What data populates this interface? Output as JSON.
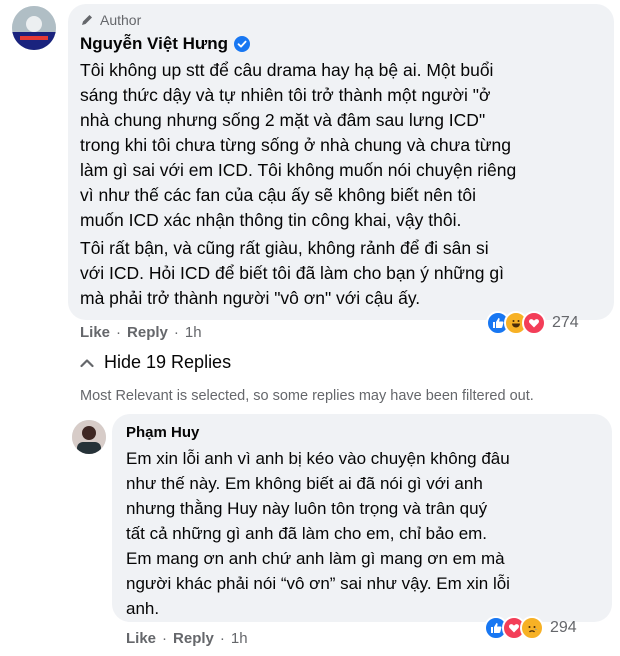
{
  "comment": {
    "author_badge": "Author",
    "author_name": "Nguyễn Việt Hưng",
    "paragraph1": [
      "Tôi không up stt để câu drama hay hạ bệ ai. Một buổi",
      "sáng thức dậy và tự nhiên tôi trở thành một người \"ở",
      "nhà chung nhưng sống 2 mặt và đâm sau lưng ICD\"",
      "trong khi tôi chưa từng sống ở nhà chung và chưa từng",
      "làm gì sai với em ICD. Tôi không muốn nói chuyện riêng",
      "vì như thế các fan của cậu ấy sẽ không biết nên tôi",
      "muốn ICD xác nhận thông tin công khai, vậy thôi."
    ],
    "paragraph2": [
      "Tôi rất bận, và cũng rất giàu, không rảnh để đi sân si",
      "với ICD. Hỏi ICD để biết tôi đã làm cho bạn ý những gì",
      "mà phải trở thành người \"vô ơn\" với cậu ấy."
    ],
    "actions": {
      "like": "Like",
      "reply": "Reply",
      "time": "1h"
    },
    "reactions": {
      "icons": [
        "like-reaction",
        "haha-reaction",
        "love-reaction"
      ],
      "count": "274"
    }
  },
  "replies_toggle": "Hide 19 Replies",
  "filter_note": "Most Relevant is selected, so some replies may have been filtered out.",
  "reply": {
    "author_name": "Phạm Huy",
    "lines": [
      "Em xin lỗi anh vì anh bị kéo vào chuyện không đâu",
      "như thế này. Em không biết ai đã nói gì với anh",
      "nhưng thằng Huy này luôn tôn trọng và trân quý",
      "tất cả những gì anh đã làm cho em, chỉ bảo em.",
      "Em mang ơn anh chứ anh làm gì mang ơn em mà",
      "người khác phải nói “vô ơn” sai như vậy. Em xin lỗi",
      "anh."
    ],
    "actions": {
      "like": "Like",
      "reply": "Reply",
      "time": "1h"
    },
    "reactions": {
      "icons": [
        "like-reaction",
        "love-reaction",
        "sad-reaction"
      ],
      "count": "294"
    }
  },
  "colors": {
    "like": "#1877f2",
    "love": "#f33e58",
    "haha": "#f7b125",
    "bubble": "#f0f2f5",
    "secondary": "#65676b"
  }
}
